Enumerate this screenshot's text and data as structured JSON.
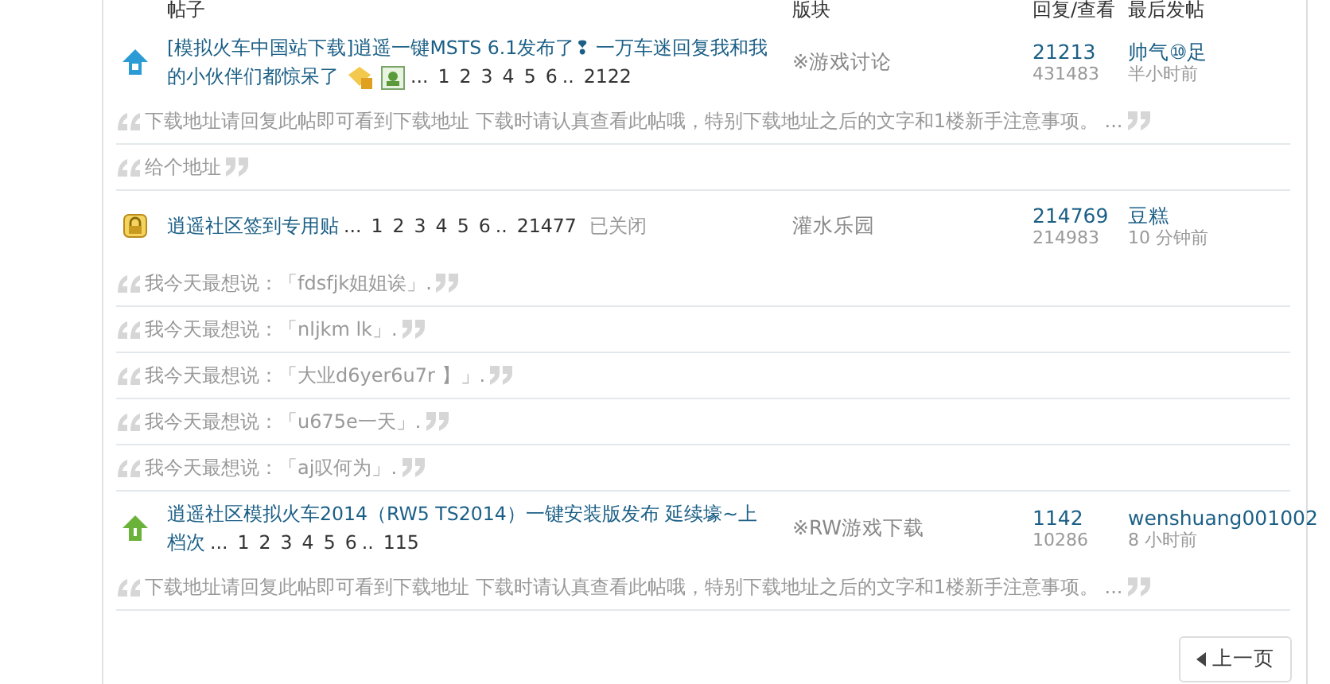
{
  "table": {
    "columns": [
      "帖子",
      "版块",
      "回复/查看",
      "最后发帖"
    ],
    "threads": [
      {
        "kind": "hot",
        "title_lines": [
          "[模拟火车中国站下载]逍遥一键MSTS 6.1发布了❢ 一万车迷回复我和我",
          "的小伙伴们都惊呆了"
        ],
        "rewarded": true,
        "has_images": true,
        "pages": [
          {
            "kind": "gap",
            "text": "..."
          },
          {
            "kind": "page",
            "text": "1"
          },
          {
            "kind": "page",
            "text": "2"
          },
          {
            "kind": "page",
            "text": "3"
          },
          {
            "kind": "page",
            "text": "4"
          },
          {
            "kind": "page",
            "text": "5"
          },
          {
            "kind": "page",
            "text": "6"
          },
          {
            "kind": "gap",
            "text": ".."
          },
          {
            "kind": "page",
            "text": "2122"
          }
        ],
        "forum": "※游戏讨论",
        "replies": "21213",
        "views": "431483",
        "last_poster": "帅气⑩足",
        "last_time": "半小时前",
        "quotes": [
          "下载地址请回复此帖即可看到下载地址 下载时请认真查看此帖哦，特别下载地址之后的文字和1楼新手注意事项。 ...",
          "给个地址"
        ]
      },
      {
        "kind": "locked",
        "title_lines": [
          "逍遥社区签到专用贴"
        ],
        "status": "已关闭",
        "pages": [
          {
            "kind": "gap",
            "text": "..."
          },
          {
            "kind": "page",
            "text": "1"
          },
          {
            "kind": "page",
            "text": "2"
          },
          {
            "kind": "page",
            "text": "3"
          },
          {
            "kind": "page",
            "text": "4"
          },
          {
            "kind": "page",
            "text": "5"
          },
          {
            "kind": "page",
            "text": "6"
          },
          {
            "kind": "gap",
            "text": ".."
          },
          {
            "kind": "page",
            "text": "21477"
          }
        ],
        "forum": "灌水乐园",
        "replies": "214769",
        "views": "214983",
        "last_poster": "豆糕",
        "last_time": "10 分钟前",
        "quotes": [
          "我今天最想说：「fdsfjk姐姐诶」.",
          "我今天最想说：「nljkm lk」.",
          "我今天最想说：「大业d6yer6u7r 】」.",
          "我今天最想说：「u675e一天」.",
          "我今天最想说：「aj叹何为」."
        ]
      },
      {
        "kind": "new",
        "title_lines": [
          "逍遥社区模拟火车2014（RW5 TS2014）一键安装版发布 延续壕~上",
          "档次"
        ],
        "pages": [
          {
            "kind": "gap",
            "text": "..."
          },
          {
            "kind": "page",
            "text": "1"
          },
          {
            "kind": "page",
            "text": "2"
          },
          {
            "kind": "page",
            "text": "3"
          },
          {
            "kind": "page",
            "text": "4"
          },
          {
            "kind": "page",
            "text": "5"
          },
          {
            "kind": "page",
            "text": "6"
          },
          {
            "kind": "gap",
            "text": ".."
          },
          {
            "kind": "page",
            "text": "115"
          }
        ],
        "forum": "※RW游戏下载",
        "replies": "1142",
        "views": "10286",
        "last_poster": "wenshuang001002",
        "last_time": "8 小时前",
        "quotes": [
          "下载地址请回复此帖即可看到下载地址 下载时请认真查看此帖哦，特别下载地址之后的文字和1楼新手注意事项。 ..."
        ]
      }
    ]
  },
  "pager": {
    "prev": "上一页"
  }
}
